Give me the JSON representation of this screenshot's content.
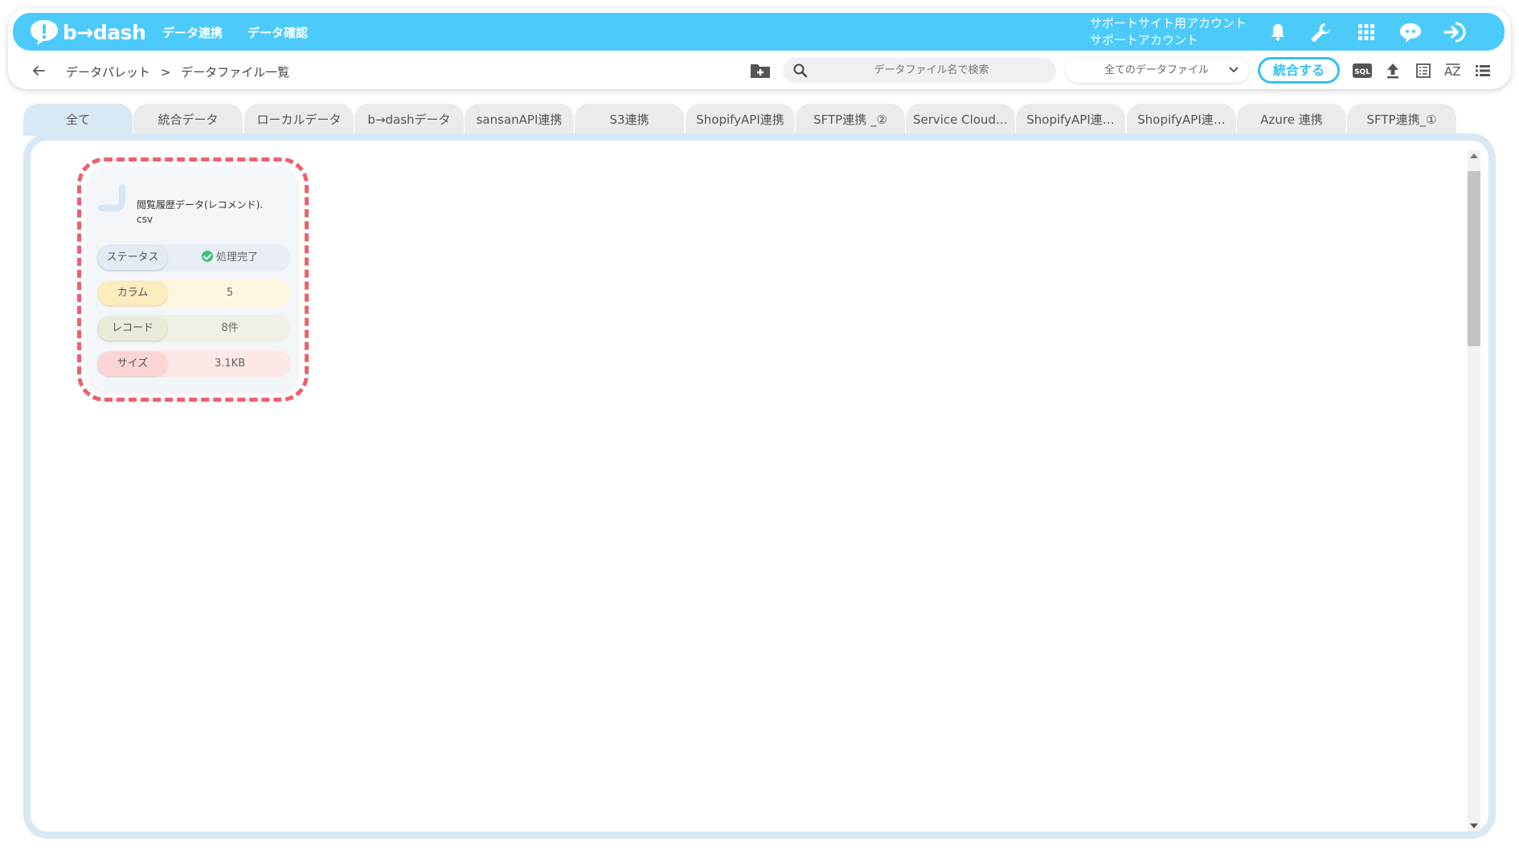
{
  "app": {
    "logo_text": "b→dash",
    "nav": [
      "データ連携",
      "データ確認"
    ],
    "account_line1": "サポートサイト用アカウント",
    "account_line2": "サポートアカウント"
  },
  "subbar": {
    "breadcrumb": [
      "データパレット",
      ">",
      "データファイル一覧"
    ],
    "search_placeholder": "データファイル名で検索",
    "file_filter": "全てのデータファイル",
    "merge_button": "統合する",
    "sql_label": "SQL",
    "sort_label": "AZ"
  },
  "tabs": [
    {
      "label": "全て",
      "active": true
    },
    {
      "label": "統合データ"
    },
    {
      "label": "ローカルデータ"
    },
    {
      "label": "b→dashデータ"
    },
    {
      "label": "sansanAPI連携"
    },
    {
      "label": "S3連携"
    },
    {
      "label": "ShopifyAPI連携"
    },
    {
      "label": "SFTP連携 _②"
    },
    {
      "label": "Service Cloud…"
    },
    {
      "label": "ShopifyAPI連…"
    },
    {
      "label": "ShopifyAPI連…"
    },
    {
      "label": "Azure 連携"
    },
    {
      "label": "SFTP連携_①"
    }
  ],
  "card": {
    "title_line1": "閲覧履歴データ(レコメンド).",
    "title_line2": "csv",
    "status_label": "ステータス",
    "status_value": "処理完了",
    "column_label": "カラム",
    "column_value": "5",
    "record_label": "レコード",
    "record_value": "8件",
    "size_label": "サイズ",
    "size_value": "3.1KB"
  },
  "colors": {
    "brand": "#4ccbfb",
    "highlight": "#ef5f6c",
    "status_ok": "#3cc07a"
  }
}
